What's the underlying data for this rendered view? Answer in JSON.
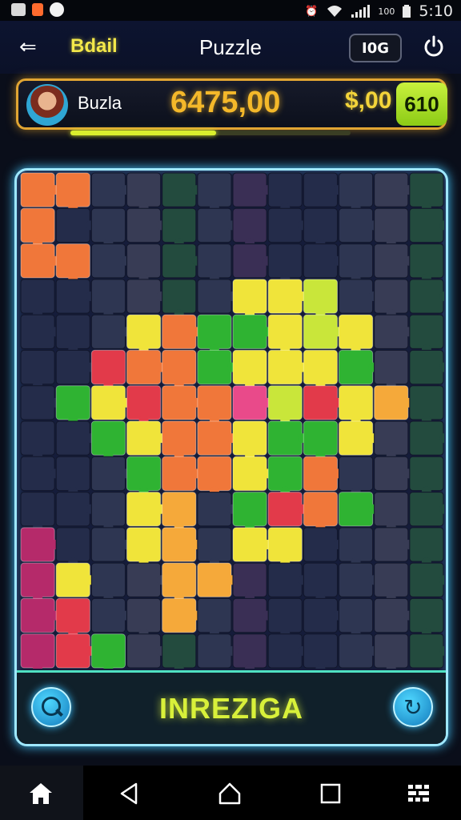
{
  "status_bar": {
    "battery": "100",
    "time": "5:10",
    "icons": [
      "photo-icon",
      "notification-icon",
      "app-icon",
      "alarm-icon",
      "wifi-icon",
      "signal-icon",
      "battery-icon"
    ]
  },
  "header": {
    "back_icon": "arrow-left-icon",
    "brand": "Bdail",
    "title": "Puzzle",
    "level_button": "I0G",
    "power_icon": "power-icon"
  },
  "player": {
    "name": "Buzla",
    "score": "6475,00",
    "coins": "$,00",
    "coin_button": "610",
    "progress": 0.52,
    "accent": "#e1a533"
  },
  "board": {
    "frame_color": "#9fe8ff",
    "footer_text": "INREZIGA",
    "hint_icon": "magnifier-icon",
    "refresh_icon": "refresh-icon"
  },
  "nav_bar": {
    "items": [
      "home-icon",
      "back-triangle-icon",
      "home-outline-icon",
      "recents-square-icon",
      "menu-grid-icon"
    ]
  }
}
